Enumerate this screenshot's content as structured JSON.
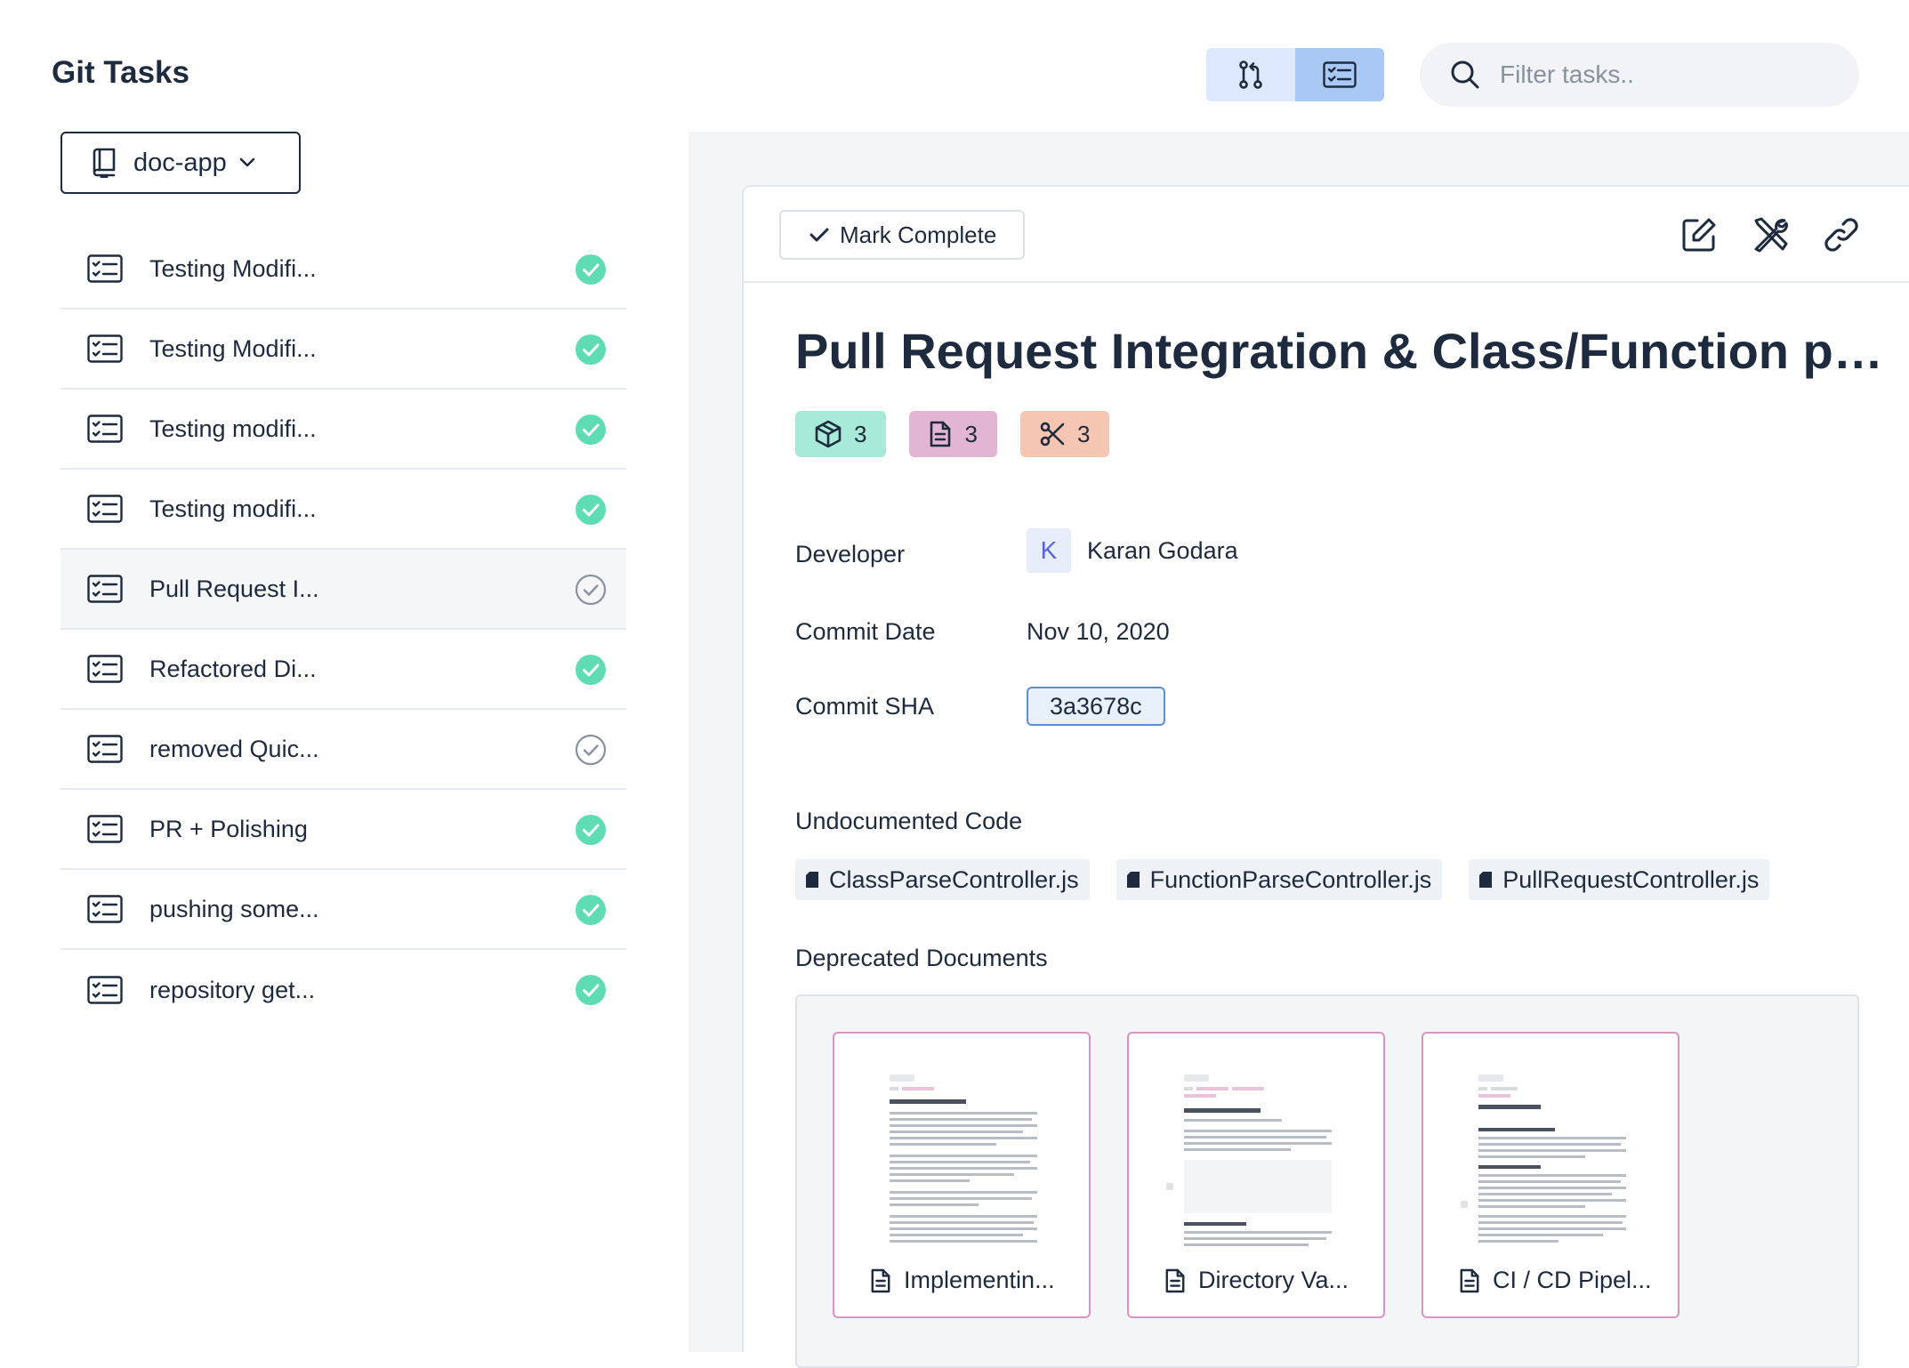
{
  "header": {
    "app_title": "Git Tasks",
    "search_placeholder": "Filter tasks.."
  },
  "repo_selector": {
    "label": "doc-app"
  },
  "tasks": [
    {
      "label": "Testing Modifi...",
      "status": "complete"
    },
    {
      "label": "Testing Modifi...",
      "status": "complete"
    },
    {
      "label": "Testing modifi...",
      "status": "complete"
    },
    {
      "label": "Testing modifi...",
      "status": "complete"
    },
    {
      "label": "Pull Request I...",
      "status": "incomplete"
    },
    {
      "label": "Refactored Di...",
      "status": "complete"
    },
    {
      "label": "removed Quic...",
      "status": "incomplete"
    },
    {
      "label": "PR + Polishing",
      "status": "complete"
    },
    {
      "label": "pushing some...",
      "status": "complete"
    },
    {
      "label": "repository get...",
      "status": "complete"
    }
  ],
  "detail": {
    "mark_complete_label": "Mark Complete",
    "title": "Pull Request Integration & Class/Function pa...",
    "badges": [
      {
        "icon": "cube-icon",
        "count": "3",
        "color": "#a7ead8"
      },
      {
        "icon": "document-icon",
        "count": "3",
        "color": "#e2b6d3"
      },
      {
        "icon": "scissors-icon",
        "count": "3",
        "color": "#f5c6b1"
      }
    ],
    "developer_label": "Developer",
    "developer_initial": "K",
    "developer_name": "Karan Godara",
    "commit_date_label": "Commit Date",
    "commit_date": "Nov 10, 2020",
    "commit_sha_label": "Commit SHA",
    "commit_sha": "3a3678c",
    "undocumented_label": "Undocumented Code",
    "undocumented_files": [
      "ClassParseController.js",
      "FunctionParseController.js",
      "PullRequestController.js"
    ],
    "deprecated_label": "Deprecated Documents",
    "deprecated_docs": [
      "Implementin...",
      "Directory Va...",
      "CI / CD Pipel..."
    ]
  },
  "colors": {
    "status_complete": "#5fdcb3",
    "toggle_active": "#a9c8f3",
    "toggle_inactive": "#dce8fb",
    "doc_border": "#d894c2"
  }
}
